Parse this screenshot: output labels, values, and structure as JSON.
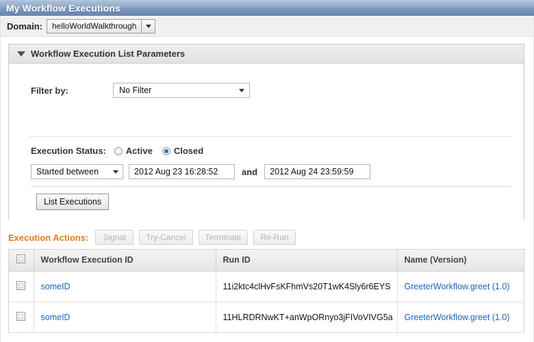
{
  "window": {
    "title": "My Workflow Executions"
  },
  "domain_bar": {
    "label": "Domain:",
    "selected": "helloWorldWalkthrough",
    "dropdown_icon": "chevron-down-icon"
  },
  "panel": {
    "collapse_icon": "triangle-down-icon",
    "title": "Workflow Execution List Parameters",
    "filter": {
      "label": "Filter by:",
      "value": "No Filter",
      "dropdown_icon": "chevron-down-icon"
    },
    "execution_status": {
      "label": "Execution Status:",
      "options": [
        {
          "label": "Active",
          "checked": false
        },
        {
          "label": "Closed",
          "checked": true
        }
      ]
    },
    "date_range": {
      "mode": "Started between",
      "mode_icon": "chevron-down-icon",
      "from": "2012 Aug 23 16:28:52",
      "conjunction": "and",
      "to": "2012 Aug 24 23:59:59"
    },
    "list_button": "List Executions"
  },
  "execution_actions": {
    "label": "Execution Actions:",
    "label_color": "#e07b1e",
    "buttons": [
      {
        "label": "Signal",
        "disabled": true
      },
      {
        "label": "Try-Cancel",
        "disabled": true
      },
      {
        "label": "Terminate",
        "disabled": true
      },
      {
        "label": "Re-Run",
        "disabled": true
      }
    ]
  },
  "table": {
    "select_all_icon": "checkbox-icon",
    "columns": [
      "Workflow Execution ID",
      "Run ID",
      "Name (Version)"
    ],
    "link_color": "#1c62b9",
    "rows": [
      {
        "checkbox_icon": "checkbox-icon",
        "workflow_execution_id": "someID",
        "run_id": "11i2ktc4clHvFsKFhmVs20T1wK4Sly6r6EYS",
        "name_version": "GreeterWorkflow.greet (1.0)"
      },
      {
        "checkbox_icon": "checkbox-icon",
        "workflow_execution_id": "someID",
        "run_id": "11HLRDRNwKT+anWpORnyo3jFIVoVIVG5a",
        "name_version": "GreeterWorkflow.greet (1.0)"
      }
    ]
  }
}
